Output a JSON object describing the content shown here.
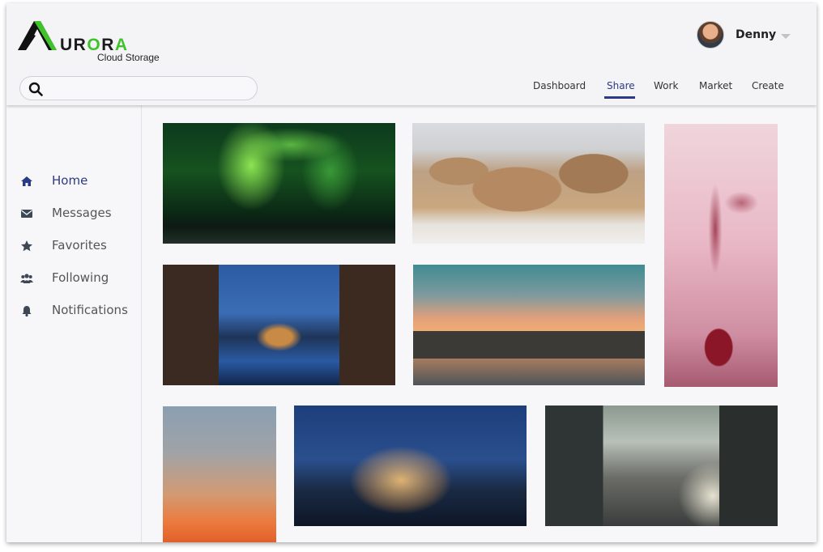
{
  "app": {
    "logo_text": "URORA",
    "logo_subtitle": "Cloud Storage"
  },
  "user": {
    "name": "Denny"
  },
  "search": {
    "placeholder": ""
  },
  "nav": {
    "items": [
      "Dashboard",
      "Share",
      "Work",
      "Market",
      "Create"
    ],
    "active": "Share"
  },
  "sidebar": {
    "items": [
      {
        "label": "Home",
        "icon": "home-icon",
        "active": true
      },
      {
        "label": "Messages",
        "icon": "envelope-icon",
        "active": false
      },
      {
        "label": "Favorites",
        "icon": "star-icon",
        "active": false
      },
      {
        "label": "Following",
        "icon": "users-icon",
        "active": false
      },
      {
        "label": "Notifications",
        "icon": "bell-icon",
        "active": false
      }
    ]
  },
  "gallery": {
    "photos": [
      {
        "name": "photo-northern-lights"
      },
      {
        "name": "photo-walruses"
      },
      {
        "name": "photo-liquid-splash"
      },
      {
        "name": "photo-canal-city-night"
      },
      {
        "name": "photo-paris-bridge-sunset"
      },
      {
        "name": "photo-sunset-sky"
      },
      {
        "name": "photo-steel-wool-pier"
      },
      {
        "name": "photo-city-street"
      }
    ]
  },
  "colors": {
    "accent": "#2c3985",
    "logo_green": "#3fc22a",
    "header_bg": "#f4f4f7",
    "sidebar_text": "#555555"
  }
}
